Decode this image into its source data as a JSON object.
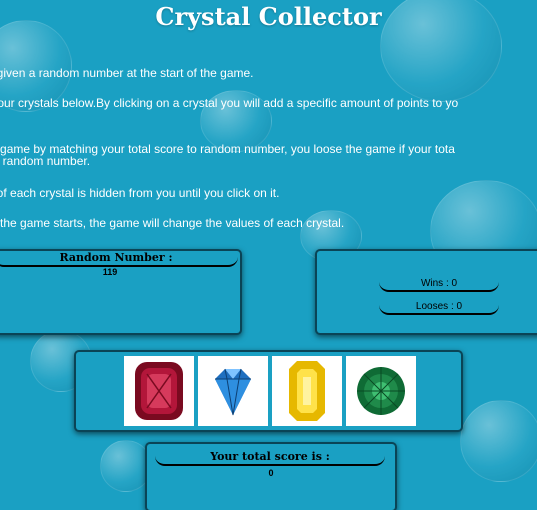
{
  "app": {
    "title": "Crystal Collector"
  },
  "instructions": [
    "be given a random number at the start of the game.",
    "re four crystals below.By clicking on a crystal you will add a specific amount of points to yo",
    " the game by matching your total score to random number, you loose the game if your tota",
    "ove random number.",
    "ue of each crystal is hidden from you until you click on it.",
    "me the game starts, the game will change the values of each crystal."
  ],
  "random_panel": {
    "header": "Random Number :",
    "value": "119"
  },
  "stats_panel": {
    "wins": "Wins : 0",
    "losses": "Looses : 0"
  },
  "crystals": [
    {
      "name": "red-crystal",
      "color": "#9b0f2a"
    },
    {
      "name": "blue-crystal",
      "color": "#1f6fbf"
    },
    {
      "name": "yellow-crystal",
      "color": "#f2d21a"
    },
    {
      "name": "green-crystal",
      "color": "#1f8a4a"
    }
  ],
  "score_panel": {
    "header": "Your total score is :",
    "value": "0"
  },
  "colors": {
    "background": "#1aa0c3",
    "panel_border": "#0a4456",
    "text": "#ffffff"
  }
}
